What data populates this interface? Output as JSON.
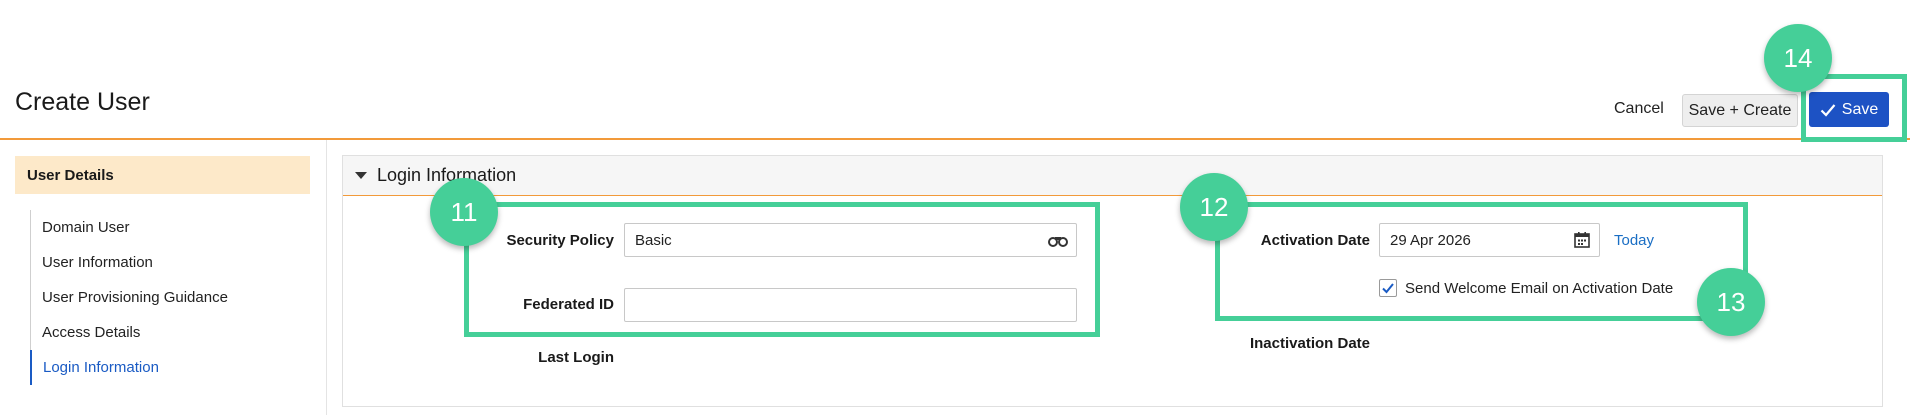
{
  "header": {
    "title": "Create User",
    "cancel_label": "Cancel",
    "save_create_label": "Save + Create",
    "save_label": "Save"
  },
  "sidebar": {
    "heading": "User Details",
    "items": [
      {
        "label": "Domain User"
      },
      {
        "label": "User Information"
      },
      {
        "label": "User Provisioning Guidance"
      },
      {
        "label": "Access Details"
      },
      {
        "label": "Login Information",
        "active": true
      }
    ]
  },
  "section": {
    "title": "Login Information",
    "security_policy": {
      "label": "Security Policy",
      "value": "Basic"
    },
    "federated_id": {
      "label": "Federated ID",
      "value": ""
    },
    "last_login": {
      "label": "Last Login"
    },
    "activation_date": {
      "label": "Activation Date",
      "value": "29 Apr 2026",
      "today_label": "Today"
    },
    "send_welcome_email": {
      "label": "Send Welcome Email on Activation Date",
      "checked": true
    },
    "inactivation_date": {
      "label": "Inactivation Date"
    }
  },
  "callouts": [
    "11",
    "12",
    "13",
    "14"
  ],
  "colors": {
    "accent_orange": "#f29a3a",
    "primary_blue": "#1d52c4",
    "callout_green": "#45cf98",
    "sidebar_active_bg": "#fde9c9"
  },
  "icons": [
    "binoculars-icon",
    "calendar-icon",
    "checkmark-icon",
    "caret-down-icon"
  ]
}
